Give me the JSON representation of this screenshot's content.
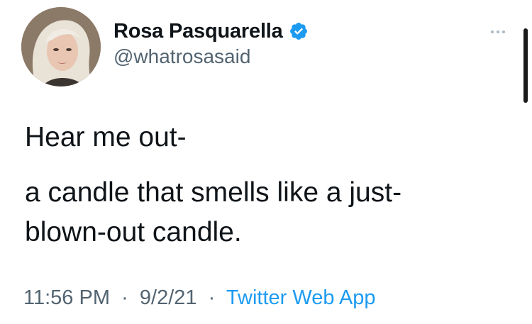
{
  "author": {
    "display_name": "Rosa Pasquarella",
    "handle": "@whatrosasaid",
    "verified": true
  },
  "tweet": {
    "lines": [
      "Hear me out-",
      "a candle that smells like a just-",
      "blown-out candle."
    ]
  },
  "meta": {
    "time": "11:56 PM",
    "date": "9/2/21",
    "separator": "·",
    "source": "Twitter Web App"
  },
  "icons": {
    "verified": "verified-badge-icon",
    "more": "more-options-icon"
  },
  "colors": {
    "verified_blue": "#1d9bf0",
    "link_blue": "#1d9bf0",
    "secondary_text": "#536471",
    "primary_text": "#0f1419"
  }
}
